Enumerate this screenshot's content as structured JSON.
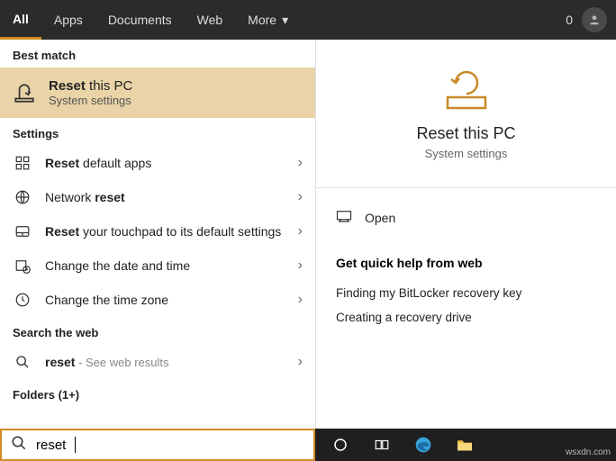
{
  "topbar": {
    "tabs": [
      "All",
      "Apps",
      "Documents",
      "Web",
      "More"
    ],
    "activeIndex": 0,
    "count": "0"
  },
  "left": {
    "bestMatchHeader": "Best match",
    "bestMatch": {
      "titleBold": "Reset",
      "titleRest": " this PC",
      "sub": "System settings"
    },
    "settingsHeader": "Settings",
    "settings": [
      {
        "bold": "Reset",
        "rest": " default apps"
      },
      {
        "pre": "Network ",
        "bold": "reset",
        "rest": ""
      },
      {
        "bold": "Reset",
        "rest": " your touchpad to its default settings"
      },
      {
        "pre": "",
        "bold": "",
        "rest": "Change the date and time"
      },
      {
        "pre": "",
        "bold": "",
        "rest": "Change the time zone"
      }
    ],
    "searchWebHeader": "Search the web",
    "webResult": {
      "bold": "reset",
      "hint": " - See web results"
    },
    "foldersHeader": "Folders (1+)"
  },
  "right": {
    "title": "Reset this PC",
    "sub": "System settings",
    "openLabel": "Open",
    "quickTitle": "Get quick help from web",
    "quickLinks": [
      "Finding my BitLocker recovery key",
      "Creating a recovery drive"
    ]
  },
  "search": {
    "value": "reset"
  },
  "watermark": "wsxdn.com"
}
